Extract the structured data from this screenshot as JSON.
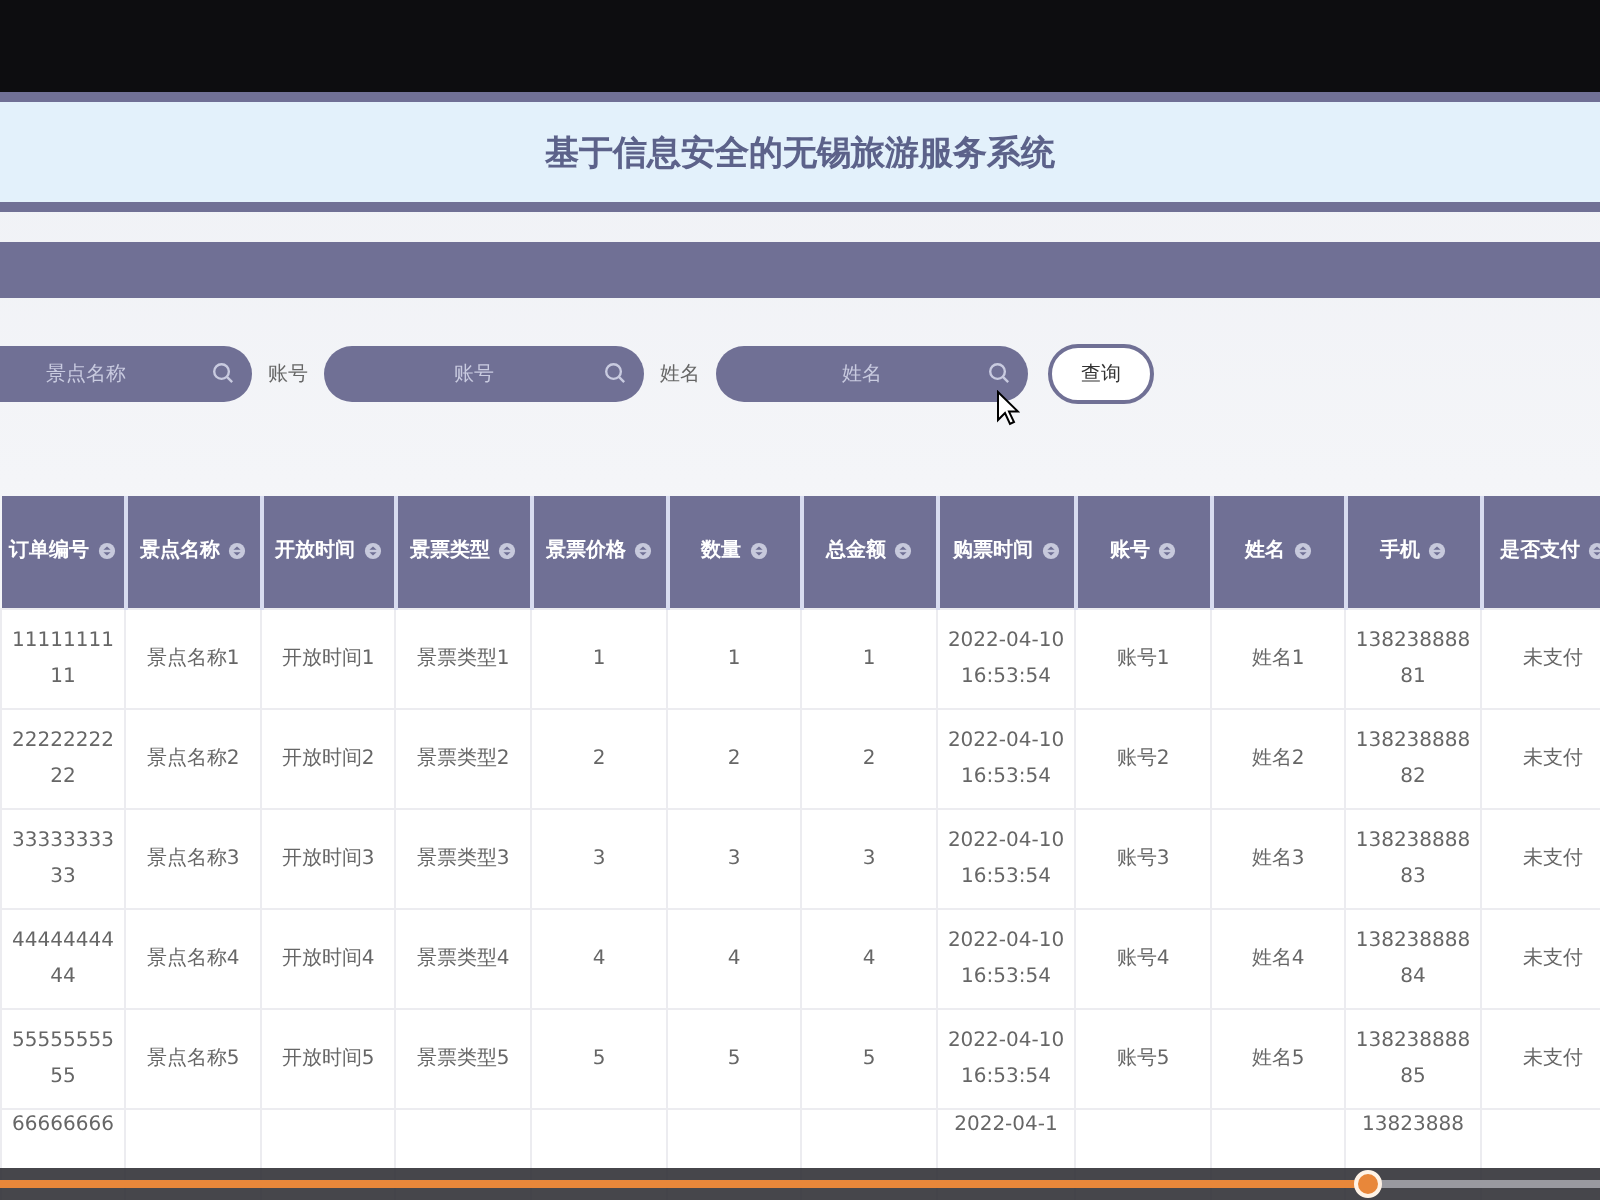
{
  "title": "基于信息安全的无锡旅游服务系统",
  "search": {
    "fields": [
      {
        "placeholder": "景点名称"
      },
      {
        "label": "账号",
        "placeholder": "账号"
      },
      {
        "label": "姓名",
        "placeholder": "姓名"
      }
    ],
    "button": "查询"
  },
  "table": {
    "columns": [
      "订单编号",
      "景点名称",
      "开放时间",
      "景票类型",
      "景票价格",
      "数量",
      "总金额",
      "购票时间",
      "账号",
      "姓名",
      "手机",
      "是否支付"
    ],
    "rows": [
      {
        "cells": [
          "1111111111",
          "景点名称1",
          "开放时间1",
          "景票类型1",
          "1",
          "1",
          "1",
          "2022-04-10 16:53:54",
          "账号1",
          "姓名1",
          "13823888881",
          "未支付"
        ]
      },
      {
        "cells": [
          "2222222222",
          "景点名称2",
          "开放时间2",
          "景票类型2",
          "2",
          "2",
          "2",
          "2022-04-10 16:53:54",
          "账号2",
          "姓名2",
          "13823888882",
          "未支付"
        ]
      },
      {
        "cells": [
          "3333333333",
          "景点名称3",
          "开放时间3",
          "景票类型3",
          "3",
          "3",
          "3",
          "2022-04-10 16:53:54",
          "账号3",
          "姓名3",
          "13823888883",
          "未支付"
        ]
      },
      {
        "cells": [
          "4444444444",
          "景点名称4",
          "开放时间4",
          "景票类型4",
          "4",
          "4",
          "4",
          "2022-04-10 16:53:54",
          "账号4",
          "姓名4",
          "13823888884",
          "未支付"
        ]
      },
      {
        "cells": [
          "5555555555",
          "景点名称5",
          "开放时间5",
          "景票类型5",
          "5",
          "5",
          "5",
          "2022-04-10 16:53:54",
          "账号5",
          "姓名5",
          "13823888885",
          "未支付"
        ]
      }
    ],
    "partial_row": {
      "cells": [
        "66666666",
        "",
        "",
        "",
        "",
        "",
        "",
        "2022-04-1",
        "",
        "",
        "13823888",
        ""
      ]
    }
  },
  "player": {
    "level": 0.855
  }
}
